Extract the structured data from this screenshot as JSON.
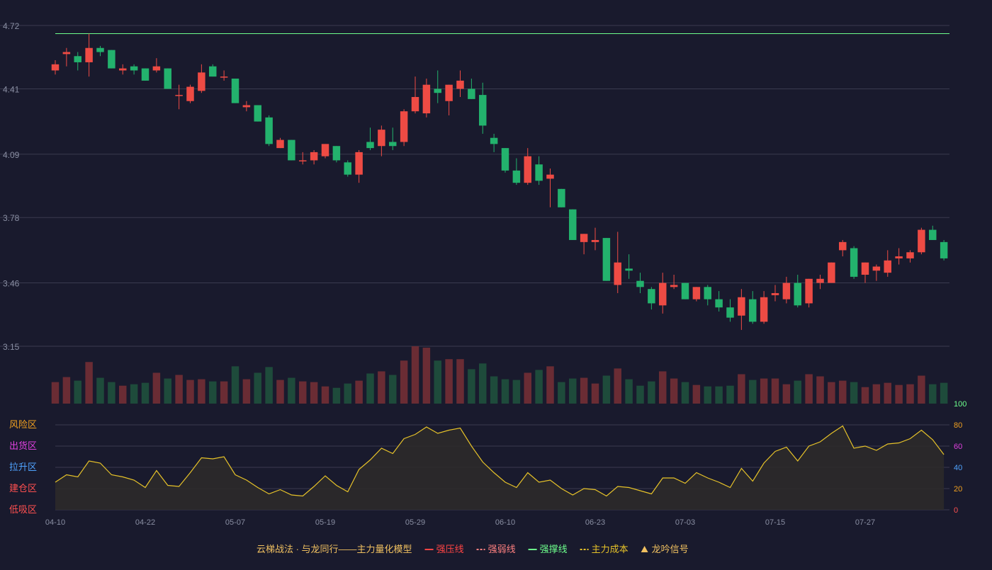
{
  "colors": {
    "background": "#191a2d",
    "up": "#ee4b44",
    "down": "#23b26d",
    "up_volume": "#6a2c34",
    "down_volume": "#1e4b3b",
    "grid": "#3a3b4f",
    "axis_text": "#8a8fa3",
    "support_line": "#6dff8c",
    "oscillator_line": "#e6c229",
    "oscillator_fill": "#2c2a2a"
  },
  "chart_data": {
    "type": "candlestick",
    "price_axis": {
      "ticks": [
        "4.72",
        "4.41",
        "4.09",
        "3.78",
        "3.46",
        "3.15"
      ],
      "ylim": [
        3.15,
        4.72
      ]
    },
    "support_line": {
      "value": 4.68
    },
    "x_tick_labels": [
      {
        "label": "04-10",
        "index": 0
      },
      {
        "label": "04-22",
        "index": 8
      },
      {
        "label": "05-07",
        "index": 16
      },
      {
        "label": "05-19",
        "index": 24
      },
      {
        "label": "05-29",
        "index": 32
      },
      {
        "label": "06-10",
        "index": 40
      },
      {
        "label": "06-23",
        "index": 48
      },
      {
        "label": "07-03",
        "index": 56
      },
      {
        "label": "07-15",
        "index": 64
      },
      {
        "label": "07-27",
        "index": 72
      }
    ],
    "candles": [
      [
        4.5,
        4.53,
        4.48,
        4.55
      ],
      [
        4.58,
        4.59,
        4.52,
        4.61
      ],
      [
        4.57,
        4.54,
        4.5,
        4.59
      ],
      [
        4.54,
        4.61,
        4.47,
        4.68
      ],
      [
        4.61,
        4.59,
        4.57,
        4.62
      ],
      [
        4.6,
        4.51,
        4.51,
        4.6
      ],
      [
        4.5,
        4.51,
        4.48,
        4.53
      ],
      [
        4.52,
        4.5,
        4.48,
        4.53
      ],
      [
        4.51,
        4.45,
        4.45,
        4.51
      ],
      [
        4.5,
        4.52,
        4.49,
        4.56
      ],
      [
        4.51,
        4.41,
        4.41,
        4.51
      ],
      [
        4.38,
        4.38,
        4.31,
        4.43
      ],
      [
        4.35,
        4.42,
        4.34,
        4.43
      ],
      [
        4.4,
        4.49,
        4.39,
        4.53
      ],
      [
        4.52,
        4.47,
        4.47,
        4.53
      ],
      [
        4.47,
        4.47,
        4.45,
        4.5
      ],
      [
        4.46,
        4.34,
        4.34,
        4.46
      ],
      [
        4.32,
        4.33,
        4.3,
        4.35
      ],
      [
        4.33,
        4.25,
        4.25,
        4.33
      ],
      [
        4.27,
        4.14,
        4.13,
        4.28
      ],
      [
        4.12,
        4.16,
        4.12,
        4.17
      ],
      [
        4.16,
        4.06,
        4.06,
        4.16
      ],
      [
        4.06,
        4.06,
        4.04,
        4.1
      ],
      [
        4.06,
        4.1,
        4.04,
        4.11
      ],
      [
        4.08,
        4.14,
        4.07,
        4.14
      ],
      [
        4.13,
        4.06,
        4.05,
        4.13
      ],
      [
        4.05,
        3.99,
        3.98,
        4.06
      ],
      [
        3.99,
        4.1,
        3.95,
        4.11
      ],
      [
        4.15,
        4.12,
        4.11,
        4.22
      ],
      [
        4.13,
        4.21,
        4.08,
        4.23
      ],
      [
        4.15,
        4.13,
        4.11,
        4.22
      ],
      [
        4.15,
        4.3,
        4.13,
        4.31
      ],
      [
        4.3,
        4.37,
        4.29,
        4.47
      ],
      [
        4.29,
        4.43,
        4.27,
        4.46
      ],
      [
        4.41,
        4.39,
        4.34,
        4.5
      ],
      [
        4.35,
        4.43,
        4.28,
        4.43
      ],
      [
        4.41,
        4.45,
        4.37,
        4.5
      ],
      [
        4.41,
        4.36,
        4.36,
        4.46
      ],
      [
        4.38,
        4.23,
        4.19,
        4.44
      ],
      [
        4.17,
        4.14,
        4.1,
        4.19
      ],
      [
        4.12,
        4.01,
        4.0,
        4.12
      ],
      [
        4.01,
        3.95,
        3.94,
        4.07
      ],
      [
        3.95,
        4.08,
        3.94,
        4.12
      ],
      [
        4.04,
        3.96,
        3.94,
        4.08
      ],
      [
        3.97,
        3.99,
        3.83,
        4.02
      ],
      [
        3.92,
        3.83,
        3.83,
        3.92
      ],
      [
        3.82,
        3.67,
        3.67,
        3.82
      ],
      [
        3.66,
        3.7,
        3.6,
        3.7
      ],
      [
        3.66,
        3.67,
        3.62,
        3.73
      ],
      [
        3.68,
        3.47,
        3.47,
        3.68
      ],
      [
        3.45,
        3.56,
        3.41,
        3.71
      ],
      [
        3.53,
        3.52,
        3.48,
        3.6
      ],
      [
        3.47,
        3.44,
        3.41,
        3.51
      ],
      [
        3.43,
        3.36,
        3.33,
        3.44
      ],
      [
        3.35,
        3.46,
        3.31,
        3.51
      ],
      [
        3.44,
        3.45,
        3.43,
        3.5
      ],
      [
        3.46,
        3.38,
        3.38,
        3.46
      ],
      [
        3.38,
        3.44,
        3.37,
        3.44
      ],
      [
        3.44,
        3.38,
        3.35,
        3.45
      ],
      [
        3.38,
        3.34,
        3.32,
        3.42
      ],
      [
        3.34,
        3.29,
        3.27,
        3.38
      ],
      [
        3.3,
        3.39,
        3.23,
        3.43
      ],
      [
        3.38,
        3.27,
        3.26,
        3.42
      ],
      [
        3.27,
        3.39,
        3.26,
        3.42
      ],
      [
        3.4,
        3.41,
        3.37,
        3.45
      ],
      [
        3.38,
        3.46,
        3.36,
        3.49
      ],
      [
        3.46,
        3.35,
        3.34,
        3.5
      ],
      [
        3.36,
        3.48,
        3.34,
        3.48
      ],
      [
        3.46,
        3.48,
        3.43,
        3.5
      ],
      [
        3.46,
        3.56,
        3.46,
        3.56
      ],
      [
        3.62,
        3.66,
        3.59,
        3.67
      ],
      [
        3.63,
        3.49,
        3.48,
        3.64
      ],
      [
        3.5,
        3.56,
        3.46,
        3.56
      ],
      [
        3.52,
        3.54,
        3.47,
        3.55
      ],
      [
        3.51,
        3.57,
        3.49,
        3.62
      ],
      [
        3.58,
        3.59,
        3.55,
        3.63
      ],
      [
        3.58,
        3.61,
        3.56,
        3.62
      ],
      [
        3.61,
        3.72,
        3.6,
        3.73
      ],
      [
        3.72,
        3.67,
        3.67,
        3.74
      ],
      [
        3.66,
        3.58,
        3.57,
        3.67
      ]
    ],
    "volume": [
      30,
      37,
      32,
      58,
      36,
      30,
      25,
      27,
      29,
      43,
      35,
      40,
      33,
      34,
      31,
      31,
      52,
      34,
      43,
      51,
      33,
      36,
      31,
      30,
      24,
      22,
      28,
      32,
      42,
      45,
      40,
      60,
      80,
      78,
      60,
      62,
      62,
      48,
      56,
      38,
      34,
      33,
      43,
      47,
      52,
      30,
      35,
      36,
      28,
      39,
      49,
      34,
      25,
      31,
      45,
      35,
      30,
      26,
      24,
      24,
      25,
      41,
      33,
      35,
      35,
      27,
      32,
      41,
      38,
      30,
      32,
      30,
      23,
      27,
      29,
      26,
      27,
      39,
      27,
      29
    ],
    "oscillator": {
      "axis_ticks": [
        100,
        80,
        60,
        40,
        20,
        0
      ],
      "zones": [
        {
          "label": "风险区",
          "level": 80,
          "color": "#f0a020"
        },
        {
          "label": "出货区",
          "level": 60,
          "color": "#e040e0"
        },
        {
          "label": "拉升区",
          "level": 40,
          "color": "#4fa3ff"
        },
        {
          "label": "建仓区",
          "level": 20,
          "color": "#ff5050"
        },
        {
          "label": "低吸区",
          "level": 0,
          "color": "#ff5050"
        }
      ],
      "tick_colors": [
        "#6dff8c",
        "#f0a020",
        "#e040e0",
        "#4fa3ff",
        "#f0a020",
        "#ff5050"
      ],
      "values": [
        26,
        33,
        31,
        46,
        44,
        33,
        31,
        28,
        21,
        37,
        23,
        22,
        35,
        49,
        48,
        50,
        33,
        28,
        21,
        15,
        19,
        14,
        13,
        22,
        32,
        23,
        17,
        38,
        47,
        58,
        53,
        67,
        71,
        78,
        72,
        75,
        77,
        60,
        45,
        35,
        26,
        21,
        35,
        26,
        28,
        20,
        14,
        20,
        19,
        13,
        22,
        21,
        18,
        15,
        30,
        30,
        25,
        35,
        30,
        26,
        21,
        39,
        27,
        44,
        55,
        59,
        46,
        60,
        64,
        72,
        79,
        58,
        60,
        56,
        62,
        63,
        67,
        75,
        66,
        52
      ]
    },
    "legend": [
      {
        "label": "云梯战法 · 与龙同行——主力量化模型",
        "marker": "none",
        "color": "#f0c060"
      },
      {
        "label": "强压线",
        "marker": "line",
        "color": "#ff4444"
      },
      {
        "label": "强弱线",
        "marker": "dash",
        "color": "#ff8080"
      },
      {
        "label": "强撑线",
        "marker": "line",
        "color": "#6dff8c"
      },
      {
        "label": "主力成本",
        "marker": "dash",
        "color": "#e6c229"
      },
      {
        "label": "龙吟信号",
        "marker": "triangle",
        "color": "#f0c060"
      }
    ]
  }
}
